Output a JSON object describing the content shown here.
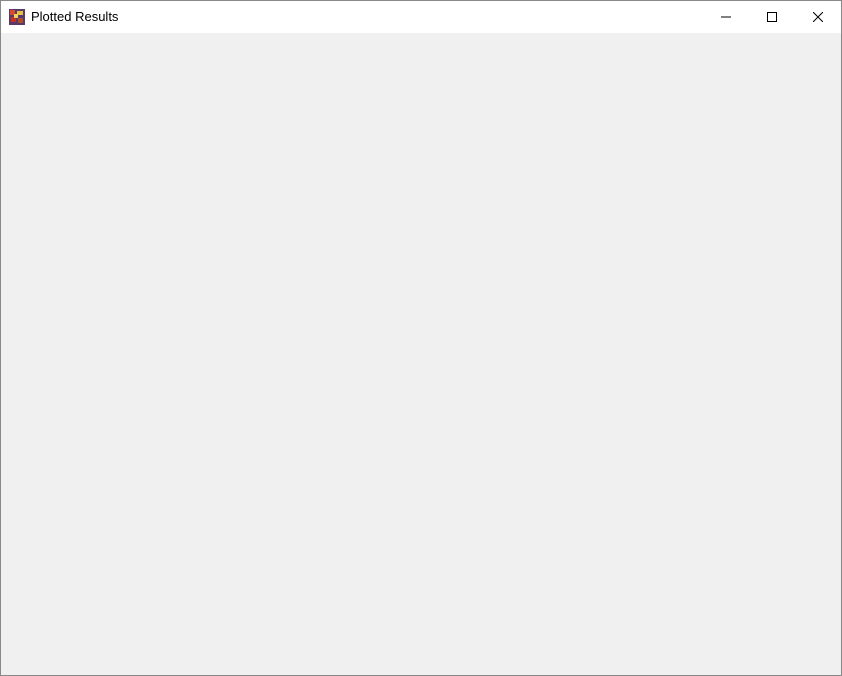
{
  "window": {
    "title": "Plotted Results"
  }
}
